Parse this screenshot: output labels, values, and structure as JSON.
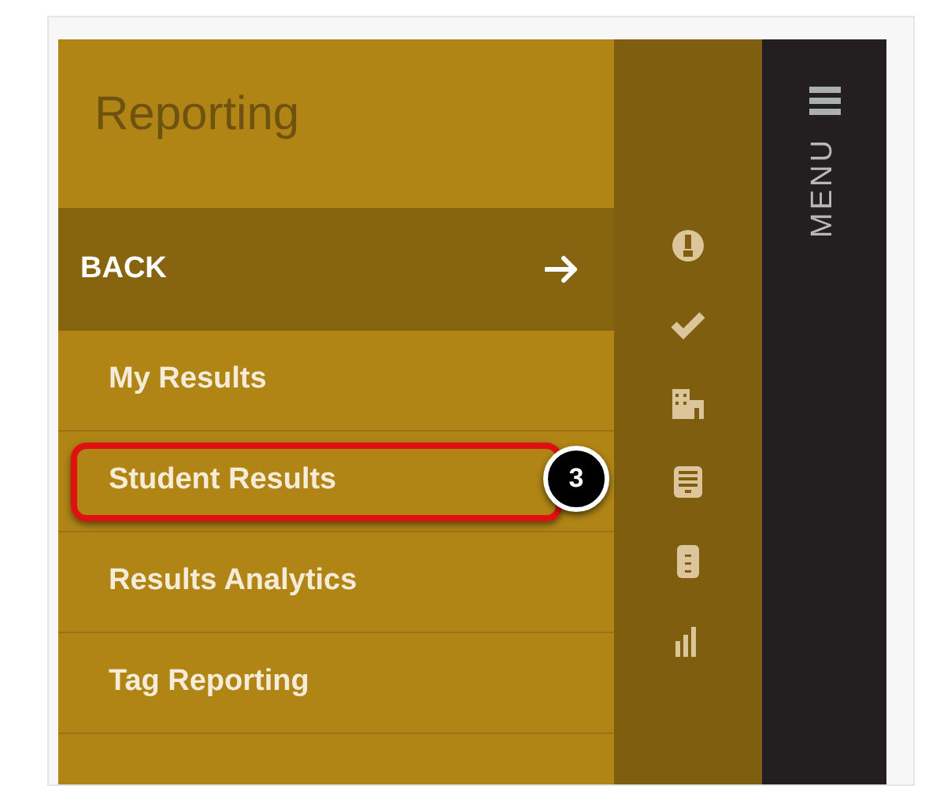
{
  "panel": {
    "title": "Reporting"
  },
  "back": {
    "label": "BACK"
  },
  "items": [
    {
      "label": "My Results",
      "highlighted": false
    },
    {
      "label": "Student Results",
      "highlighted": true,
      "step": "3"
    },
    {
      "label": "Results Analytics",
      "highlighted": false
    },
    {
      "label": "Tag Reporting",
      "highlighted": false
    }
  ],
  "icon_strip": [
    {
      "kind": "bulb"
    },
    {
      "kind": "check"
    },
    {
      "kind": "building"
    },
    {
      "kind": "tray"
    },
    {
      "kind": "cabinet"
    },
    {
      "kind": "chart"
    }
  ],
  "menu": {
    "label": "MENU"
  }
}
